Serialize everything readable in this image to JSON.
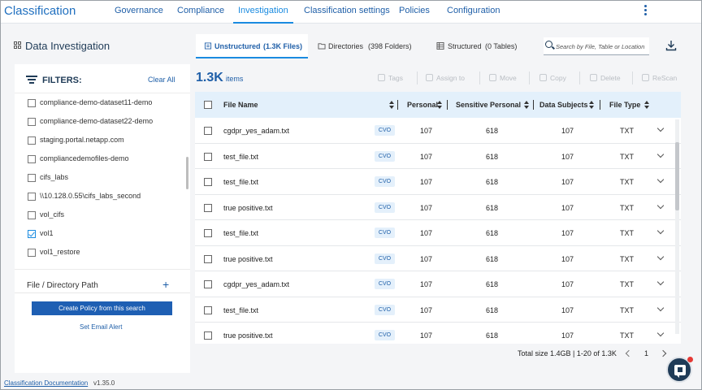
{
  "nav": {
    "brand": "Classification",
    "tabs": [
      "Governance",
      "Compliance",
      "Investigation",
      "Classification settings",
      "Policies",
      "Configuration"
    ],
    "active_tab": "Investigation"
  },
  "left": {
    "title": "Data Investigation",
    "filters_label": "FILTERS:",
    "clear_all": "Clear All",
    "items": [
      {
        "label": "compliance-demo-dataset11-demo",
        "checked": false
      },
      {
        "label": "compliance-demo-dataset22-demo",
        "checked": false
      },
      {
        "label": "staging.portal.netapp.com",
        "checked": false
      },
      {
        "label": "compliancedemofiles-demo",
        "checked": false
      },
      {
        "label": "cifs_labs",
        "checked": false
      },
      {
        "label": "\\\\10.128.0.55\\cifs_labs_second",
        "checked": false
      },
      {
        "label": "vol_cifs",
        "checked": false
      },
      {
        "label": "vol1",
        "checked": true
      },
      {
        "label": "vol1_restore",
        "checked": false
      }
    ],
    "path_label": "File / Directory Path",
    "path_plus": "+",
    "create_policy": "Create Policy from this search",
    "email_alert": "Set Email Alert"
  },
  "views": {
    "unstructured": "Unstructured",
    "unstructured_count": "(1.3K Files)",
    "directories": "Directories",
    "directories_count": "(398 Folders)",
    "structured": "Structured",
    "structured_count": "(0 Tables)"
  },
  "search": {
    "placeholder": "Search by File, Table or Location"
  },
  "toolbar": {
    "count": "1.3K",
    "count_unit": "items",
    "actions": [
      "Tags",
      "Assign to",
      "Move",
      "Copy",
      "Delete",
      "ReScan"
    ]
  },
  "table": {
    "columns": [
      "File Name",
      "Personal",
      "Sensitive Personal",
      "Data Subjects",
      "File Type"
    ],
    "rows": [
      {
        "name": "cgdpr_yes_adam.txt",
        "tag": "CVO",
        "personal": "107",
        "sensitive": "618",
        "subjects": "107",
        "type": "TXT"
      },
      {
        "name": "test_file.txt",
        "tag": "CVO",
        "personal": "107",
        "sensitive": "618",
        "subjects": "107",
        "type": "TXT"
      },
      {
        "name": "test_file.txt",
        "tag": "CVO",
        "personal": "107",
        "sensitive": "618",
        "subjects": "107",
        "type": "TXT"
      },
      {
        "name": "true positive.txt",
        "tag": "CVO",
        "personal": "107",
        "sensitive": "618",
        "subjects": "107",
        "type": "TXT"
      },
      {
        "name": "test_file.txt",
        "tag": "CVO",
        "personal": "107",
        "sensitive": "618",
        "subjects": "107",
        "type": "TXT"
      },
      {
        "name": "true positive.txt",
        "tag": "CVO",
        "personal": "107",
        "sensitive": "618",
        "subjects": "107",
        "type": "TXT"
      },
      {
        "name": "cgdpr_yes_adam.txt",
        "tag": "CVO",
        "personal": "107",
        "sensitive": "618",
        "subjects": "107",
        "type": "TXT"
      },
      {
        "name": "test_file.txt",
        "tag": "CVO",
        "personal": "107",
        "sensitive": "618",
        "subjects": "107",
        "type": "TXT"
      },
      {
        "name": "true positive.txt",
        "tag": "CVO",
        "personal": "107",
        "sensitive": "618",
        "subjects": "107",
        "type": "TXT"
      }
    ]
  },
  "pager": {
    "summary": "Total size 1.4GB | 1-20 of 1.3K",
    "page": "1"
  },
  "footer": {
    "doc_link": "Classification Documentation",
    "version": "v1.35.0"
  },
  "colors": {
    "accent": "#1a8be0",
    "brand": "#1f5fa8",
    "button": "#1e5fb3",
    "header_row": "#e3f0fb"
  }
}
